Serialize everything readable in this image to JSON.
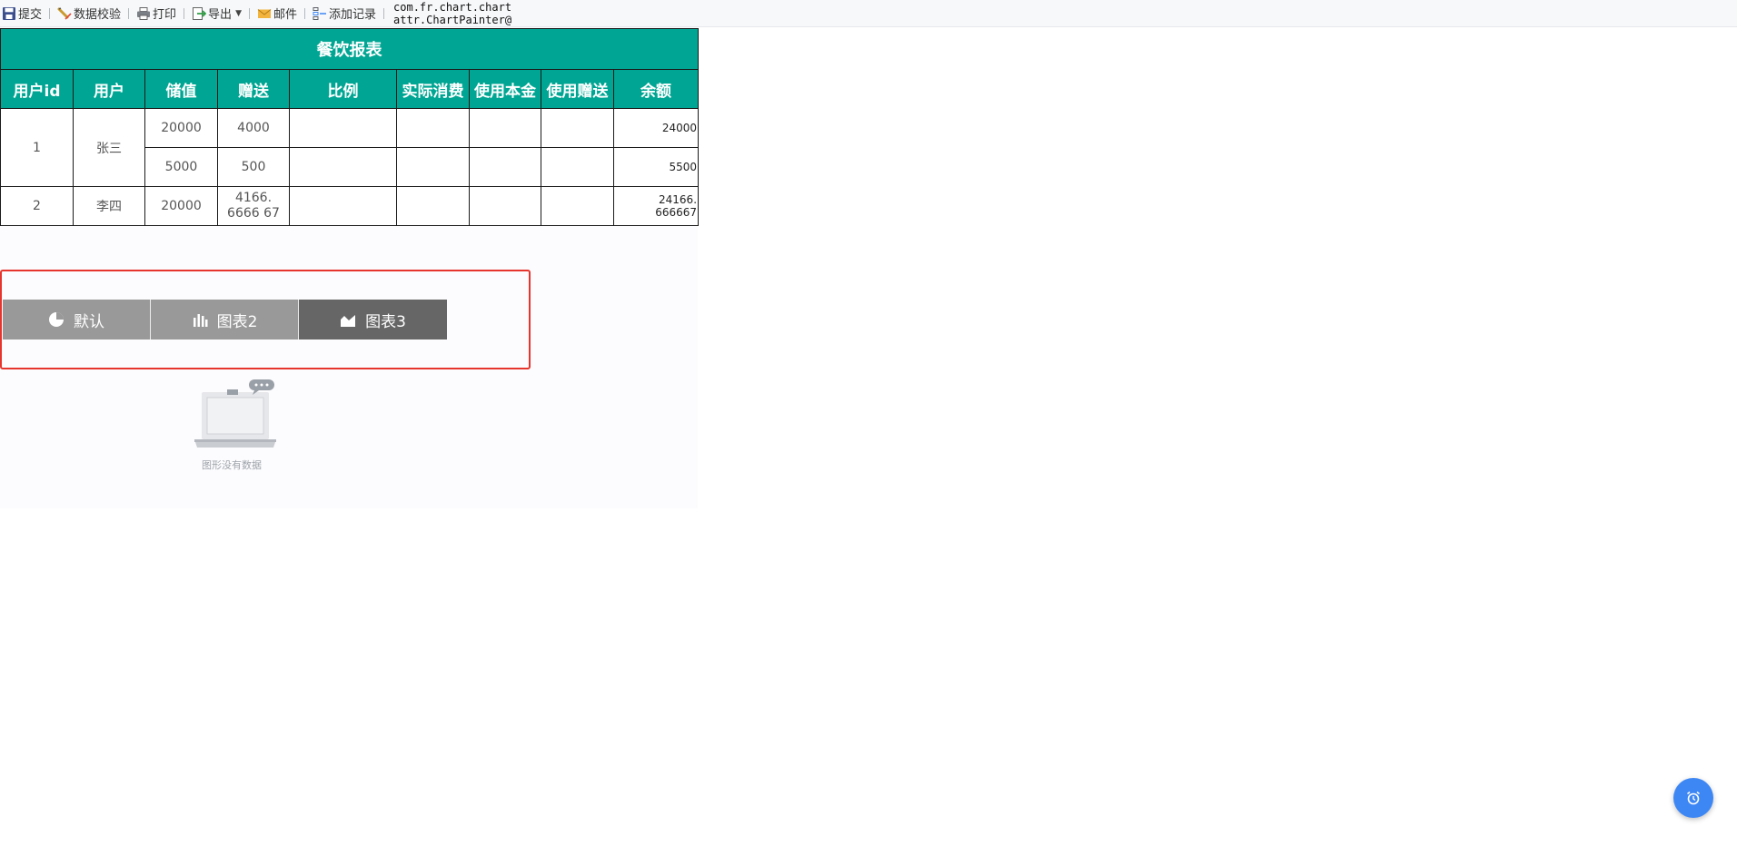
{
  "toolbar": {
    "submit": "提交",
    "validate": "数据校验",
    "print": "打印",
    "export": "导出",
    "mail": "邮件",
    "add_record": "添加记录",
    "note_line1": "com.fr.chart.chart",
    "note_line2": "attr.ChartPainter@"
  },
  "report": {
    "title": "餐饮报表",
    "columns": [
      "用户id",
      "用户",
      "储值",
      "赠送",
      "比例",
      "实际消费",
      "使用本金",
      "使用赠送",
      "余额"
    ],
    "rows": [
      {
        "id": "1",
        "user": "张三",
        "deposit": "20000",
        "bonus": "4000",
        "balance": "24000"
      },
      {
        "deposit": "5000",
        "bonus": "500",
        "balance": "5500"
      },
      {
        "id": "2",
        "user": "李四",
        "deposit": "20000",
        "bonus": "4166. 6666 67",
        "balance": "24166. 666667"
      }
    ]
  },
  "chart_tabs": [
    {
      "label": "默认",
      "icon": "pie-chart-icon",
      "active": false
    },
    {
      "label": "图表2",
      "icon": "bar-chart-icon",
      "active": false
    },
    {
      "label": "图表3",
      "icon": "area-chart-icon",
      "active": true
    }
  ],
  "empty_chart": {
    "message": "图形没有数据"
  },
  "colors": {
    "header_bg": "#00a693",
    "tab_inactive": "#999999",
    "tab_active": "#666666",
    "highlight_border": "#e5352d",
    "fab": "#3d87f5"
  }
}
